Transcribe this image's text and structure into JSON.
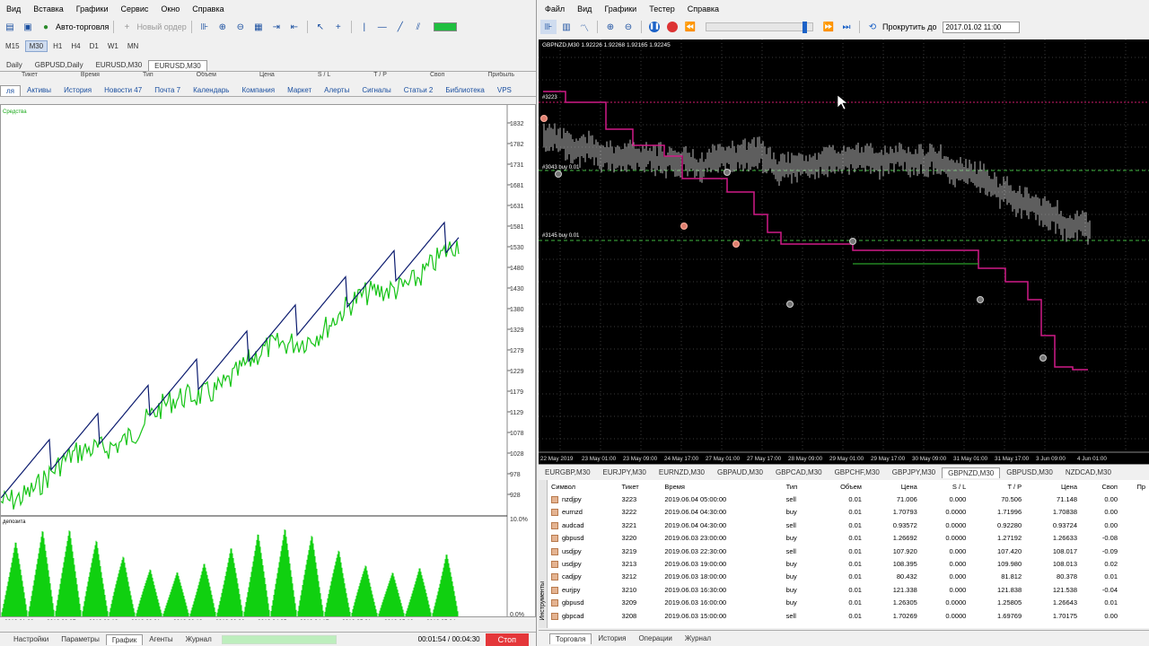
{
  "left": {
    "menu": [
      "Вид",
      "Вставка",
      "Графики",
      "Сервис",
      "Окно",
      "Справка"
    ],
    "toolbar": {
      "autotrade_label": "Авто-торговля",
      "new_order_label": "Новый ордер"
    },
    "timeframes": [
      "M15",
      "M30",
      "H1",
      "H4",
      "D1",
      "W1",
      "MN"
    ],
    "active_timeframe": "M30",
    "chart_tabs": [
      "Daily",
      "GBPUSD,Daily",
      "EURUSD,M30",
      "EURUSD,M30"
    ],
    "hidden_columns": [
      "Тикет",
      "Время",
      "Тип",
      "Объем",
      "Цена",
      "S / L",
      "T / P",
      "Своп",
      "Прибыль"
    ],
    "terminal_tabs": [
      "ля",
      "Активы",
      "История",
      "Новости 47",
      "Почта 7",
      "Календарь",
      "Компания",
      "Маркет",
      "Алерты",
      "Сигналы",
      "Статьи 2",
      "Библиотека",
      "VPS"
    ],
    "top_chart_label": "Средства",
    "bottom_chart_label": "депозита",
    "price_axis": [
      "1832",
      "1782",
      "1731",
      "1681",
      "1631",
      "1581",
      "1530",
      "1480",
      "1430",
      "1380",
      "1329",
      "1279",
      "1229",
      "1179",
      "1129",
      "1078",
      "1028",
      "978",
      "928"
    ],
    "pct_axis": [
      "10.0%",
      "0.0%"
    ],
    "date_axis": [
      "2019.01.28",
      "2019.02.07",
      "2019.02.19",
      "2019.03.01",
      "2019.03.13",
      "2019.03.26",
      "2019.04.05",
      "2019.04.17",
      "2019.05.01",
      "2019.05.13",
      "2019.05.24"
    ],
    "bottom_tabs": [
      "Настройки",
      "Параметры",
      "График",
      "Агенты",
      "Журнал"
    ],
    "active_bottom_tab": "График",
    "timer": "00:01:54 / 00:04:30",
    "stop_label": "Стоп",
    "colors": {
      "balance": "#0a1a6e",
      "equity": "#17c417",
      "deposit": "#10d010"
    }
  },
  "right": {
    "menu": [
      "Файл",
      "Вид",
      "Графики",
      "Тестер",
      "Справка"
    ],
    "scroll_label": "Прокрутить до",
    "scroll_date": "2017.01.02 11:00",
    "chart_header": "GBPNZD,M30  1.92226 1.92268 1.92165 1.92245",
    "order_labels": [
      "#3223",
      "#3043 buy 0.01",
      "#3145 buy 0.01"
    ],
    "date_axis": [
      "22 May 2019",
      "23 May 01:00",
      "23 May 09:00",
      "24 May 17:00",
      "27 May 01:00",
      "27 May 17:00",
      "28 May 09:00",
      "29 May 01:00",
      "29 May 17:00",
      "30 May 09:00",
      "31 May 01:00",
      "31 May 17:00",
      "3 Jun 09:00",
      "4 Jun 01:00"
    ],
    "symbol_tabs": [
      "EURGBP,M30",
      "EURJPY,M30",
      "EURNZD,M30",
      "GBPAUD,M30",
      "GBPCAD,M30",
      "GBPCHF,M30",
      "GBPJPY,M30",
      "GBPNZD,M30",
      "GBPUSD,M30",
      "NZDCAD,M30"
    ],
    "active_symbol_tab": "GBPNZD,M30",
    "table": {
      "headers": [
        "Символ",
        "Тикет",
        "Время",
        "Тип",
        "Объем",
        "Цена",
        "S / L",
        "T / P",
        "Цена",
        "Своп",
        "Пр"
      ],
      "rows": [
        [
          "nzdjpy",
          "3223",
          "2019.06.04 05:00:00",
          "sell",
          "0.01",
          "71.006",
          "0.000",
          "70.506",
          "71.148",
          "0.00"
        ],
        [
          "eurnzd",
          "3222",
          "2019.06.04 04:30:00",
          "buy",
          "0.01",
          "1.70793",
          "0.0000",
          "1.71996",
          "1.70838",
          "0.00"
        ],
        [
          "audcad",
          "3221",
          "2019.06.04 04:30:00",
          "sell",
          "0.01",
          "0.93572",
          "0.0000",
          "0.92280",
          "0.93724",
          "0.00"
        ],
        [
          "gbpusd",
          "3220",
          "2019.06.03 23:00:00",
          "buy",
          "0.01",
          "1.26692",
          "0.0000",
          "1.27192",
          "1.26633",
          "-0.08"
        ],
        [
          "usdjpy",
          "3219",
          "2019.06.03 22:30:00",
          "sell",
          "0.01",
          "107.920",
          "0.000",
          "107.420",
          "108.017",
          "-0.09"
        ],
        [
          "usdjpy",
          "3213",
          "2019.06.03 19:00:00",
          "buy",
          "0.01",
          "108.395",
          "0.000",
          "109.980",
          "108.013",
          "0.02"
        ],
        [
          "cadjpy",
          "3212",
          "2019.06.03 18:00:00",
          "buy",
          "0.01",
          "80.432",
          "0.000",
          "81.812",
          "80.378",
          "0.01"
        ],
        [
          "eurjpy",
          "3210",
          "2019.06.03 16:30:00",
          "buy",
          "0.01",
          "121.338",
          "0.000",
          "121.838",
          "121.538",
          "-0.04"
        ],
        [
          "gbpusd",
          "3209",
          "2019.06.03 16:00:00",
          "buy",
          "0.01",
          "1.26305",
          "0.0000",
          "1.25805",
          "1.26643",
          "0.01"
        ],
        [
          "gbpcad",
          "3208",
          "2019.06.03 15:00:00",
          "sell",
          "0.01",
          "1.70269",
          "0.0000",
          "1.69769",
          "1.70175",
          "0.00"
        ]
      ]
    },
    "bottom_tabs": [
      "Торговля",
      "История",
      "Операции",
      "Журнал"
    ],
    "active_bottom_tab": "Торговля",
    "side_label": "Инструменты"
  }
}
